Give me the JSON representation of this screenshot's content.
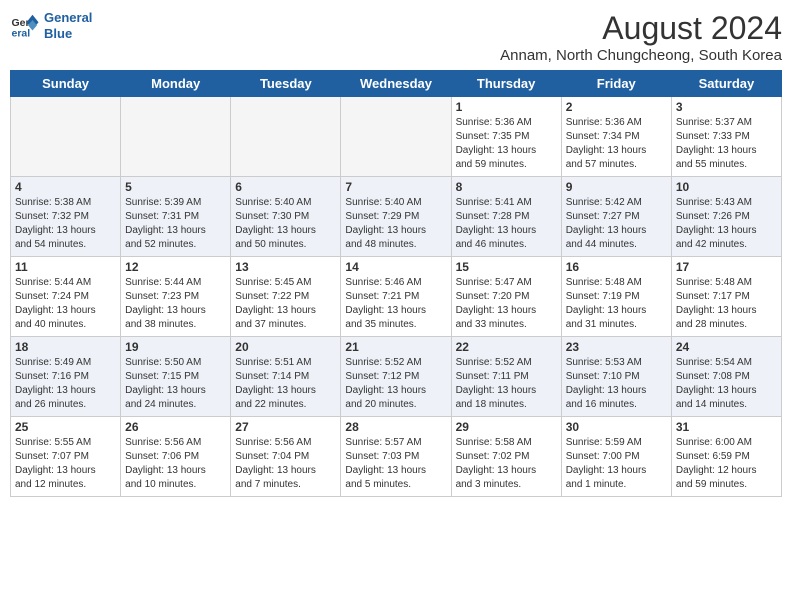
{
  "logo": {
    "line1": "General",
    "line2": "Blue"
  },
  "title": "August 2024",
  "subtitle": "Annam, North Chungcheong, South Korea",
  "days_of_week": [
    "Sunday",
    "Monday",
    "Tuesday",
    "Wednesday",
    "Thursday",
    "Friday",
    "Saturday"
  ],
  "weeks": [
    [
      {
        "day": "",
        "content": ""
      },
      {
        "day": "",
        "content": ""
      },
      {
        "day": "",
        "content": ""
      },
      {
        "day": "",
        "content": ""
      },
      {
        "day": "1",
        "content": "Sunrise: 5:36 AM\nSunset: 7:35 PM\nDaylight: 13 hours\nand 59 minutes."
      },
      {
        "day": "2",
        "content": "Sunrise: 5:36 AM\nSunset: 7:34 PM\nDaylight: 13 hours\nand 57 minutes."
      },
      {
        "day": "3",
        "content": "Sunrise: 5:37 AM\nSunset: 7:33 PM\nDaylight: 13 hours\nand 55 minutes."
      }
    ],
    [
      {
        "day": "4",
        "content": "Sunrise: 5:38 AM\nSunset: 7:32 PM\nDaylight: 13 hours\nand 54 minutes."
      },
      {
        "day": "5",
        "content": "Sunrise: 5:39 AM\nSunset: 7:31 PM\nDaylight: 13 hours\nand 52 minutes."
      },
      {
        "day": "6",
        "content": "Sunrise: 5:40 AM\nSunset: 7:30 PM\nDaylight: 13 hours\nand 50 minutes."
      },
      {
        "day": "7",
        "content": "Sunrise: 5:40 AM\nSunset: 7:29 PM\nDaylight: 13 hours\nand 48 minutes."
      },
      {
        "day": "8",
        "content": "Sunrise: 5:41 AM\nSunset: 7:28 PM\nDaylight: 13 hours\nand 46 minutes."
      },
      {
        "day": "9",
        "content": "Sunrise: 5:42 AM\nSunset: 7:27 PM\nDaylight: 13 hours\nand 44 minutes."
      },
      {
        "day": "10",
        "content": "Sunrise: 5:43 AM\nSunset: 7:26 PM\nDaylight: 13 hours\nand 42 minutes."
      }
    ],
    [
      {
        "day": "11",
        "content": "Sunrise: 5:44 AM\nSunset: 7:24 PM\nDaylight: 13 hours\nand 40 minutes."
      },
      {
        "day": "12",
        "content": "Sunrise: 5:44 AM\nSunset: 7:23 PM\nDaylight: 13 hours\nand 38 minutes."
      },
      {
        "day": "13",
        "content": "Sunrise: 5:45 AM\nSunset: 7:22 PM\nDaylight: 13 hours\nand 37 minutes."
      },
      {
        "day": "14",
        "content": "Sunrise: 5:46 AM\nSunset: 7:21 PM\nDaylight: 13 hours\nand 35 minutes."
      },
      {
        "day": "15",
        "content": "Sunrise: 5:47 AM\nSunset: 7:20 PM\nDaylight: 13 hours\nand 33 minutes."
      },
      {
        "day": "16",
        "content": "Sunrise: 5:48 AM\nSunset: 7:19 PM\nDaylight: 13 hours\nand 31 minutes."
      },
      {
        "day": "17",
        "content": "Sunrise: 5:48 AM\nSunset: 7:17 PM\nDaylight: 13 hours\nand 28 minutes."
      }
    ],
    [
      {
        "day": "18",
        "content": "Sunrise: 5:49 AM\nSunset: 7:16 PM\nDaylight: 13 hours\nand 26 minutes."
      },
      {
        "day": "19",
        "content": "Sunrise: 5:50 AM\nSunset: 7:15 PM\nDaylight: 13 hours\nand 24 minutes."
      },
      {
        "day": "20",
        "content": "Sunrise: 5:51 AM\nSunset: 7:14 PM\nDaylight: 13 hours\nand 22 minutes."
      },
      {
        "day": "21",
        "content": "Sunrise: 5:52 AM\nSunset: 7:12 PM\nDaylight: 13 hours\nand 20 minutes."
      },
      {
        "day": "22",
        "content": "Sunrise: 5:52 AM\nSunset: 7:11 PM\nDaylight: 13 hours\nand 18 minutes."
      },
      {
        "day": "23",
        "content": "Sunrise: 5:53 AM\nSunset: 7:10 PM\nDaylight: 13 hours\nand 16 minutes."
      },
      {
        "day": "24",
        "content": "Sunrise: 5:54 AM\nSunset: 7:08 PM\nDaylight: 13 hours\nand 14 minutes."
      }
    ],
    [
      {
        "day": "25",
        "content": "Sunrise: 5:55 AM\nSunset: 7:07 PM\nDaylight: 13 hours\nand 12 minutes."
      },
      {
        "day": "26",
        "content": "Sunrise: 5:56 AM\nSunset: 7:06 PM\nDaylight: 13 hours\nand 10 minutes."
      },
      {
        "day": "27",
        "content": "Sunrise: 5:56 AM\nSunset: 7:04 PM\nDaylight: 13 hours\nand 7 minutes."
      },
      {
        "day": "28",
        "content": "Sunrise: 5:57 AM\nSunset: 7:03 PM\nDaylight: 13 hours\nand 5 minutes."
      },
      {
        "day": "29",
        "content": "Sunrise: 5:58 AM\nSunset: 7:02 PM\nDaylight: 13 hours\nand 3 minutes."
      },
      {
        "day": "30",
        "content": "Sunrise: 5:59 AM\nSunset: 7:00 PM\nDaylight: 13 hours\nand 1 minute."
      },
      {
        "day": "31",
        "content": "Sunrise: 6:00 AM\nSunset: 6:59 PM\nDaylight: 12 hours\nand 59 minutes."
      }
    ]
  ]
}
